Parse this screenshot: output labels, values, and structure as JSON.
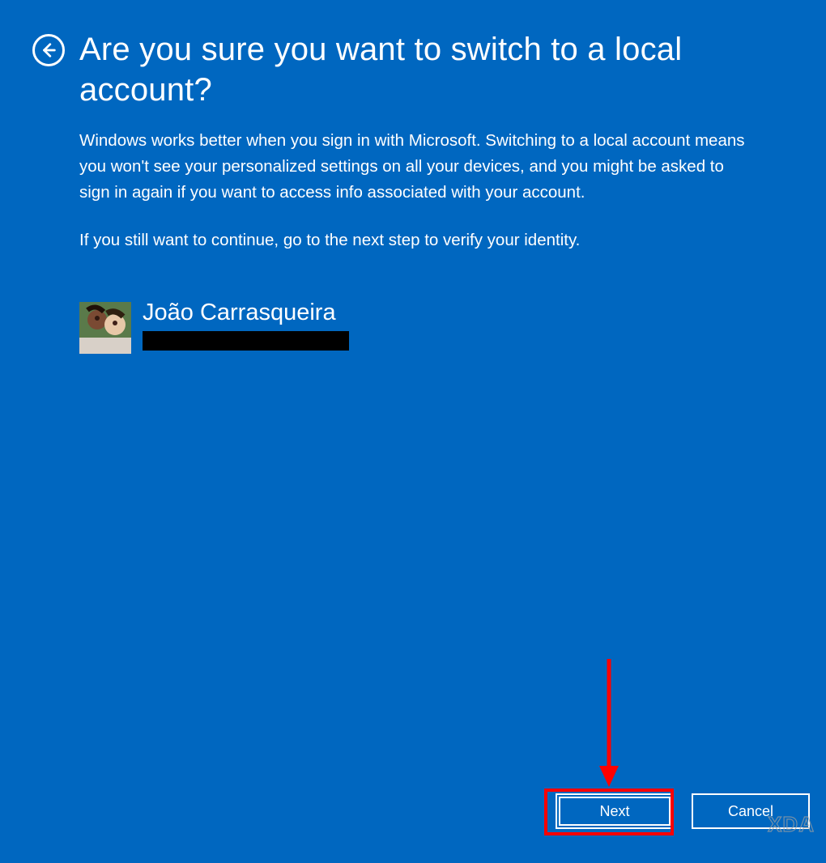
{
  "title": "Are you sure you want to switch to a local account?",
  "paragraph1": "Windows works better when you sign in with Microsoft. Switching to a local account means you won't see your personalized settings on all your devices, and you might be asked to sign in again if you want to access info associated with your account.",
  "paragraph2": "If you still want to continue, go to the next step to verify your identity.",
  "account": {
    "name": "João Carrasqueira",
    "email_redacted": true
  },
  "buttons": {
    "next": "Next",
    "cancel": "Cancel"
  },
  "watermark": "XDA",
  "annotation": {
    "arrow_target": "next-button",
    "highlight_target": "next-button"
  },
  "colors": {
    "background": "#0067c0",
    "text": "#ffffff",
    "annotation": "#ff0000"
  }
}
